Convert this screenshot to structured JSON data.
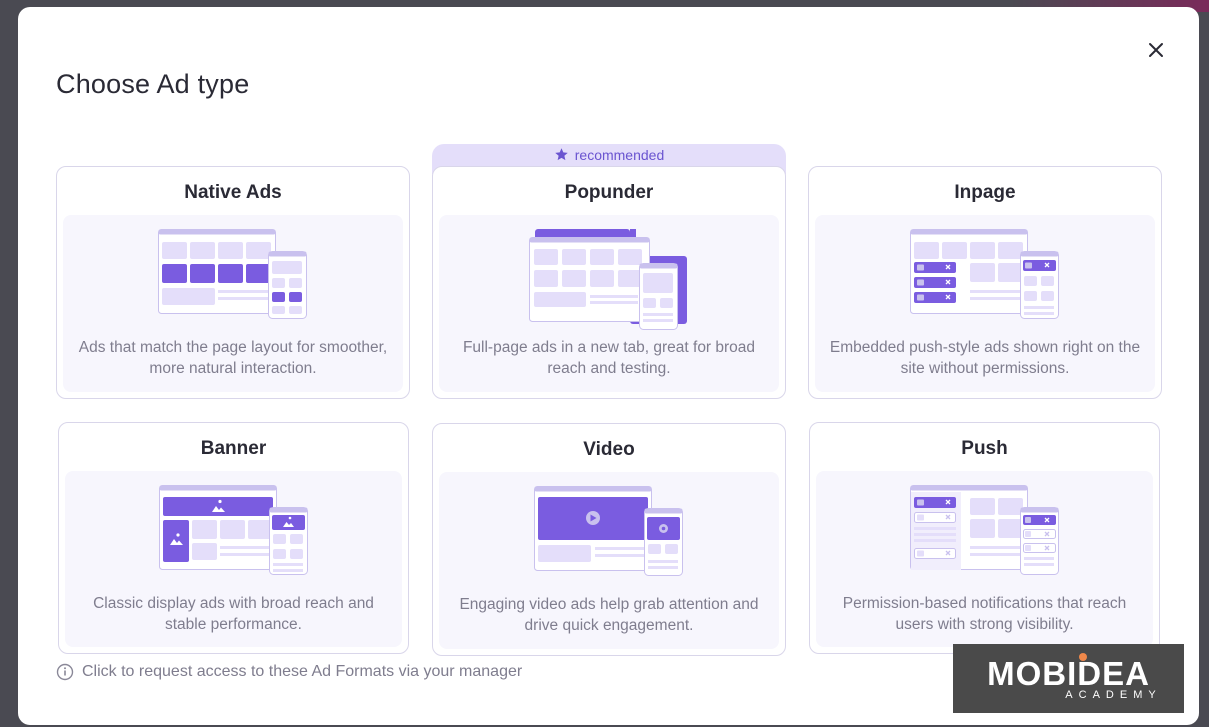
{
  "dialog": {
    "title": "Choose Ad type",
    "close_icon": "close-icon"
  },
  "recommended": {
    "label": "recommended",
    "icon": "star-icon"
  },
  "cards": [
    {
      "title": "Native Ads",
      "description": "Ads that match the page layout for smoother, more natural interaction.",
      "illustration": "native-ads-illustration"
    },
    {
      "title": "Popunder",
      "description": "Full-page ads in a new tab, great for broad reach and testing.",
      "illustration": "popunder-illustration"
    },
    {
      "title": "Inpage",
      "description": "Embedded push-style ads shown right on the site without permissions.",
      "illustration": "inpage-illustration"
    },
    {
      "title": "Banner",
      "description": "Classic display ads with broad reach and stable performance.",
      "illustration": "banner-illustration"
    },
    {
      "title": "Video",
      "description": "Engaging video ads help grab attention and drive quick engagement.",
      "illustration": "video-illustration"
    },
    {
      "title": "Push",
      "description": "Permission-based notifications that reach users with strong visibility.",
      "illustration": "push-illustration"
    }
  ],
  "footer": {
    "text": "Click to request access to these Ad Formats via your manager",
    "icon": "info-icon"
  },
  "watermark": {
    "name": "MOBIDEA",
    "sub": "ACADEMY"
  },
  "colors": {
    "accent": "#7a5ce0",
    "accent_light": "#e4defa",
    "card_border": "#d9d6ea",
    "card_inner_bg": "#f7f6fd",
    "text_dark": "#2a2a35",
    "text_muted": "#7f7d8e"
  }
}
